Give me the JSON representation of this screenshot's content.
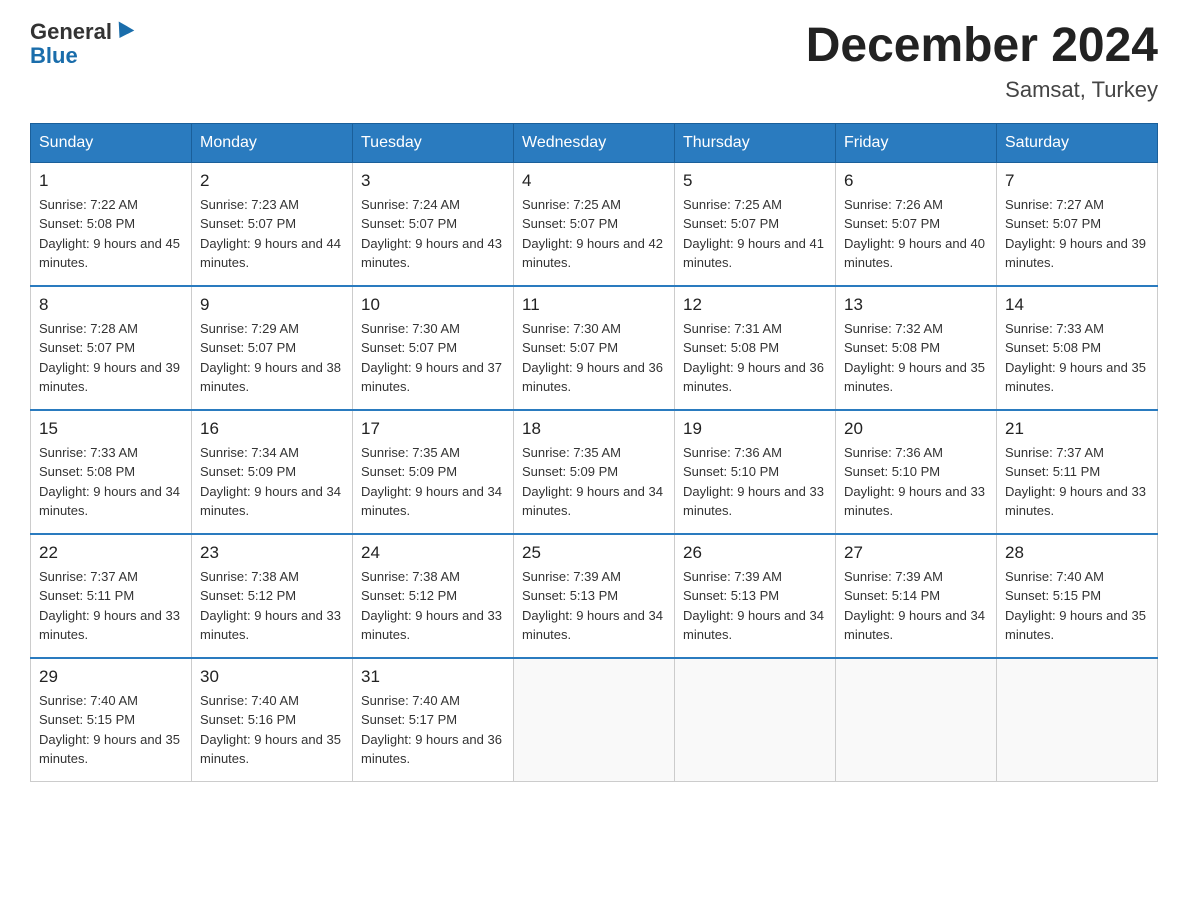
{
  "header": {
    "logo_general": "General",
    "logo_blue": "Blue",
    "title": "December 2024",
    "subtitle": "Samsat, Turkey"
  },
  "weekdays": [
    "Sunday",
    "Monday",
    "Tuesday",
    "Wednesday",
    "Thursday",
    "Friday",
    "Saturday"
  ],
  "weeks": [
    [
      {
        "day": "1",
        "sunrise": "7:22 AM",
        "sunset": "5:08 PM",
        "daylight": "9 hours and 45 minutes."
      },
      {
        "day": "2",
        "sunrise": "7:23 AM",
        "sunset": "5:07 PM",
        "daylight": "9 hours and 44 minutes."
      },
      {
        "day": "3",
        "sunrise": "7:24 AM",
        "sunset": "5:07 PM",
        "daylight": "9 hours and 43 minutes."
      },
      {
        "day": "4",
        "sunrise": "7:25 AM",
        "sunset": "5:07 PM",
        "daylight": "9 hours and 42 minutes."
      },
      {
        "day": "5",
        "sunrise": "7:25 AM",
        "sunset": "5:07 PM",
        "daylight": "9 hours and 41 minutes."
      },
      {
        "day": "6",
        "sunrise": "7:26 AM",
        "sunset": "5:07 PM",
        "daylight": "9 hours and 40 minutes."
      },
      {
        "day": "7",
        "sunrise": "7:27 AM",
        "sunset": "5:07 PM",
        "daylight": "9 hours and 39 minutes."
      }
    ],
    [
      {
        "day": "8",
        "sunrise": "7:28 AM",
        "sunset": "5:07 PM",
        "daylight": "9 hours and 39 minutes."
      },
      {
        "day": "9",
        "sunrise": "7:29 AM",
        "sunset": "5:07 PM",
        "daylight": "9 hours and 38 minutes."
      },
      {
        "day": "10",
        "sunrise": "7:30 AM",
        "sunset": "5:07 PM",
        "daylight": "9 hours and 37 minutes."
      },
      {
        "day": "11",
        "sunrise": "7:30 AM",
        "sunset": "5:07 PM",
        "daylight": "9 hours and 36 minutes."
      },
      {
        "day": "12",
        "sunrise": "7:31 AM",
        "sunset": "5:08 PM",
        "daylight": "9 hours and 36 minutes."
      },
      {
        "day": "13",
        "sunrise": "7:32 AM",
        "sunset": "5:08 PM",
        "daylight": "9 hours and 35 minutes."
      },
      {
        "day": "14",
        "sunrise": "7:33 AM",
        "sunset": "5:08 PM",
        "daylight": "9 hours and 35 minutes."
      }
    ],
    [
      {
        "day": "15",
        "sunrise": "7:33 AM",
        "sunset": "5:08 PM",
        "daylight": "9 hours and 34 minutes."
      },
      {
        "day": "16",
        "sunrise": "7:34 AM",
        "sunset": "5:09 PM",
        "daylight": "9 hours and 34 minutes."
      },
      {
        "day": "17",
        "sunrise": "7:35 AM",
        "sunset": "5:09 PM",
        "daylight": "9 hours and 34 minutes."
      },
      {
        "day": "18",
        "sunrise": "7:35 AM",
        "sunset": "5:09 PM",
        "daylight": "9 hours and 34 minutes."
      },
      {
        "day": "19",
        "sunrise": "7:36 AM",
        "sunset": "5:10 PM",
        "daylight": "9 hours and 33 minutes."
      },
      {
        "day": "20",
        "sunrise": "7:36 AM",
        "sunset": "5:10 PM",
        "daylight": "9 hours and 33 minutes."
      },
      {
        "day": "21",
        "sunrise": "7:37 AM",
        "sunset": "5:11 PM",
        "daylight": "9 hours and 33 minutes."
      }
    ],
    [
      {
        "day": "22",
        "sunrise": "7:37 AM",
        "sunset": "5:11 PM",
        "daylight": "9 hours and 33 minutes."
      },
      {
        "day": "23",
        "sunrise": "7:38 AM",
        "sunset": "5:12 PM",
        "daylight": "9 hours and 33 minutes."
      },
      {
        "day": "24",
        "sunrise": "7:38 AM",
        "sunset": "5:12 PM",
        "daylight": "9 hours and 33 minutes."
      },
      {
        "day": "25",
        "sunrise": "7:39 AM",
        "sunset": "5:13 PM",
        "daylight": "9 hours and 34 minutes."
      },
      {
        "day": "26",
        "sunrise": "7:39 AM",
        "sunset": "5:13 PM",
        "daylight": "9 hours and 34 minutes."
      },
      {
        "day": "27",
        "sunrise": "7:39 AM",
        "sunset": "5:14 PM",
        "daylight": "9 hours and 34 minutes."
      },
      {
        "day": "28",
        "sunrise": "7:40 AM",
        "sunset": "5:15 PM",
        "daylight": "9 hours and 35 minutes."
      }
    ],
    [
      {
        "day": "29",
        "sunrise": "7:40 AM",
        "sunset": "5:15 PM",
        "daylight": "9 hours and 35 minutes."
      },
      {
        "day": "30",
        "sunrise": "7:40 AM",
        "sunset": "5:16 PM",
        "daylight": "9 hours and 35 minutes."
      },
      {
        "day": "31",
        "sunrise": "7:40 AM",
        "sunset": "5:17 PM",
        "daylight": "9 hours and 36 minutes."
      },
      null,
      null,
      null,
      null
    ]
  ]
}
